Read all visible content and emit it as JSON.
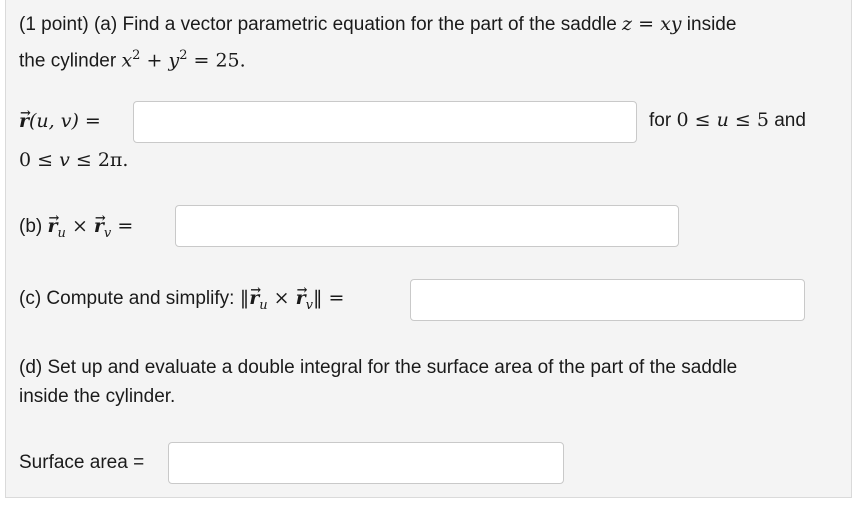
{
  "problem": {
    "points": "(1 point)",
    "part_a_prefix": "(a) Find a vector parametric equation for the part of the saddle",
    "saddle_eq_lhs": "z",
    "saddle_eq_rhs": "xy",
    "part_a_after_saddle": "inside",
    "line2_prefix": "the cylinder",
    "cyl_x": "x",
    "cyl_y": "y",
    "cyl_exp": "2",
    "cyl_value": "25.",
    "r_label": "r",
    "r_args": "(u, v)",
    "for_text": "for",
    "u_range_low": "0",
    "u_var": "u",
    "u_range_high": "5",
    "and_text": "and",
    "v_range_low": "0",
    "v_var": "v",
    "v_range_high": "2π.",
    "part_b_label": "(b)",
    "part_c_label": "(c) Compute and simplify:",
    "part_d_line1": "(d) Set up and evaluate a double integral for the surface area of the part of the saddle",
    "part_d_line2": "inside the cylinder.",
    "surface_area_label": "Surface area ="
  },
  "inputs": {
    "r_value": "",
    "cross_value": "",
    "norm_value": "",
    "area_value": ""
  }
}
